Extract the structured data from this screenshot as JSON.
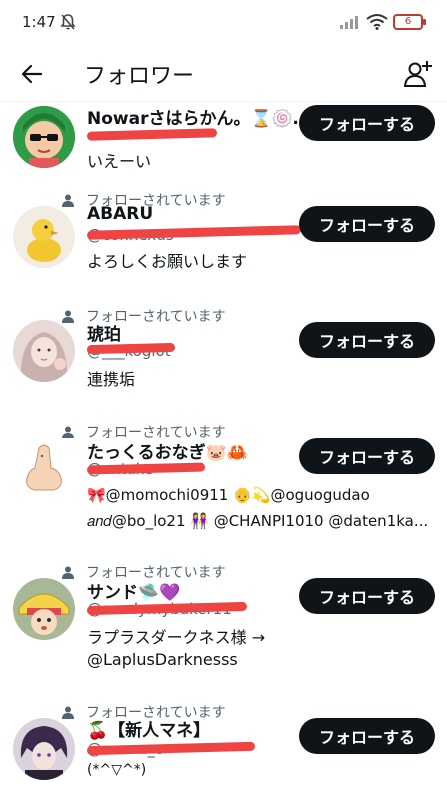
{
  "status_bar": {
    "time": "1:47",
    "battery": "6"
  },
  "header": {
    "title": "フォロワー"
  },
  "follows_you_label": "フォローされています",
  "follow_label": "フォローする",
  "users": [
    {
      "name": "Nowarさはらかん。⌛🍥…",
      "bio": "いえーい"
    },
    {
      "name": "ABARU",
      "handle": "@connexus",
      "bio": "よろしくお願いします"
    },
    {
      "name": "琥珀",
      "handle": "@___kogiot",
      "bio": "連携垢"
    },
    {
      "name": "たっくるおなぎ🐷🦀",
      "handle": "@ontake",
      "bio_line1": "🎀@momochi0911 👴💫@oguogudao",
      "bio_line2": "𝑎𝑛𝑑@bo_lo21 👭 @CHANPI1010 @daten1ka..."
    },
    {
      "name": "サンド🛸💜",
      "handle": "@sandymybaker11",
      "bio_line1": "ラプラスダークネス様 →",
      "bio_line2": "@LaplusDarknesss"
    },
    {
      "name": "🍒【新人マネ】",
      "handle": "@marru_o",
      "bio": "(*^▽^*)"
    }
  ],
  "colors": {
    "follow_button_bg": "#0f1419",
    "redaction": "#ee4444",
    "muted_text": "#536471"
  }
}
